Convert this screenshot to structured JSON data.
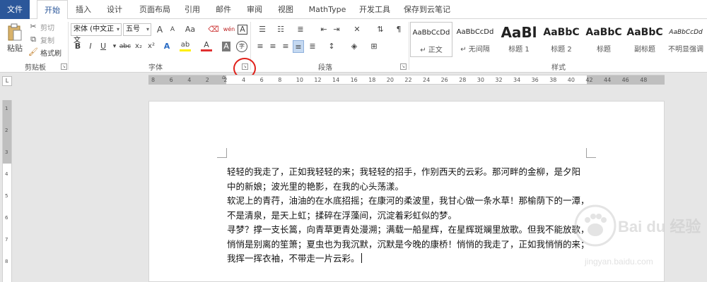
{
  "tabs": [
    {
      "label": "文件"
    },
    {
      "label": "开始"
    },
    {
      "label": "插入"
    },
    {
      "label": "设计"
    },
    {
      "label": "页面布局"
    },
    {
      "label": "引用"
    },
    {
      "label": "邮件"
    },
    {
      "label": "审阅"
    },
    {
      "label": "视图"
    },
    {
      "label": "MathType"
    },
    {
      "label": "开发工具"
    },
    {
      "label": "保存到云笔记"
    }
  ],
  "clipboard": {
    "paste": "粘贴",
    "cut": "剪切",
    "copy": "复制",
    "format_painter": "格式刷",
    "group_label": "剪贴板"
  },
  "font": {
    "family": "宋体 (中文正文",
    "size": "五号",
    "grow": "A",
    "shrink": "A",
    "case": "Aa",
    "phonetic": "wén",
    "border_char": "A",
    "bold": "B",
    "italic": "I",
    "underline": "U",
    "strike": "abc",
    "subscript": "x₂",
    "superscript": "x²",
    "effects": "A",
    "highlight": "ab",
    "color": "A",
    "shading": "A",
    "enclose": "字",
    "group_label": "字体"
  },
  "paragraph": {
    "group_label": "段落"
  },
  "styles": {
    "group_label": "样式",
    "items": [
      {
        "preview": "AaBbCcDd",
        "name": "↵ 正文"
      },
      {
        "preview": "AaBbCcDd",
        "name": "↵ 无间隔"
      },
      {
        "preview": "AaBl",
        "name": "标题 1"
      },
      {
        "preview": "AaBbC",
        "name": "标题 2"
      },
      {
        "preview": "AaBbC",
        "name": "标题"
      },
      {
        "preview": "AaBbC",
        "name": "副标题"
      },
      {
        "preview": "AaBbCcDd",
        "name": "不明显强调"
      }
    ]
  },
  "ruler": {
    "h_numbers": [
      "8",
      "6",
      "4",
      "2",
      "2",
      "4",
      "6",
      "8",
      "10",
      "12",
      "14",
      "16",
      "18",
      "20",
      "22",
      "24",
      "26",
      "28",
      "30",
      "32",
      "34",
      "36",
      "38",
      "40",
      "42",
      "44",
      "46",
      "48"
    ],
    "v_numbers": [
      "1",
      "2",
      "3",
      "4",
      "5",
      "6",
      "7",
      "8"
    ]
  },
  "document": {
    "lines": [
      "轻轻的我走了，正如我轻轻的来；我轻轻的招手，作别西天的云彩。那河畔的金柳，是夕阳",
      "中的新娘；波光里的艳影，在我的心头荡漾。",
      "软泥上的青荇，油油的在水底招摇；在康河的柔波里，我甘心做一条水草！那榆荫下的一潭，",
      "不是清泉，是天上虹；揉碎在浮藻间，沉淀着彩虹似的梦。",
      "寻梦？撑一支长篙，向青草更青处漫溯；满载一船星辉，在星辉斑斓里放歌。但我不能放歌，",
      "悄悄是别离的笙箫；夏虫也为我沉默，沉默是今晚的康桥！悄悄的我走了，正如我悄悄的来；",
      "我挥一挥衣袖，不带走一片云彩。"
    ]
  },
  "watermark": {
    "text": "Bai du 经验",
    "url": "jingyan.baidu.com"
  },
  "colors": {
    "accent": "#2b579a",
    "highlight_circle": "#e0201a"
  }
}
